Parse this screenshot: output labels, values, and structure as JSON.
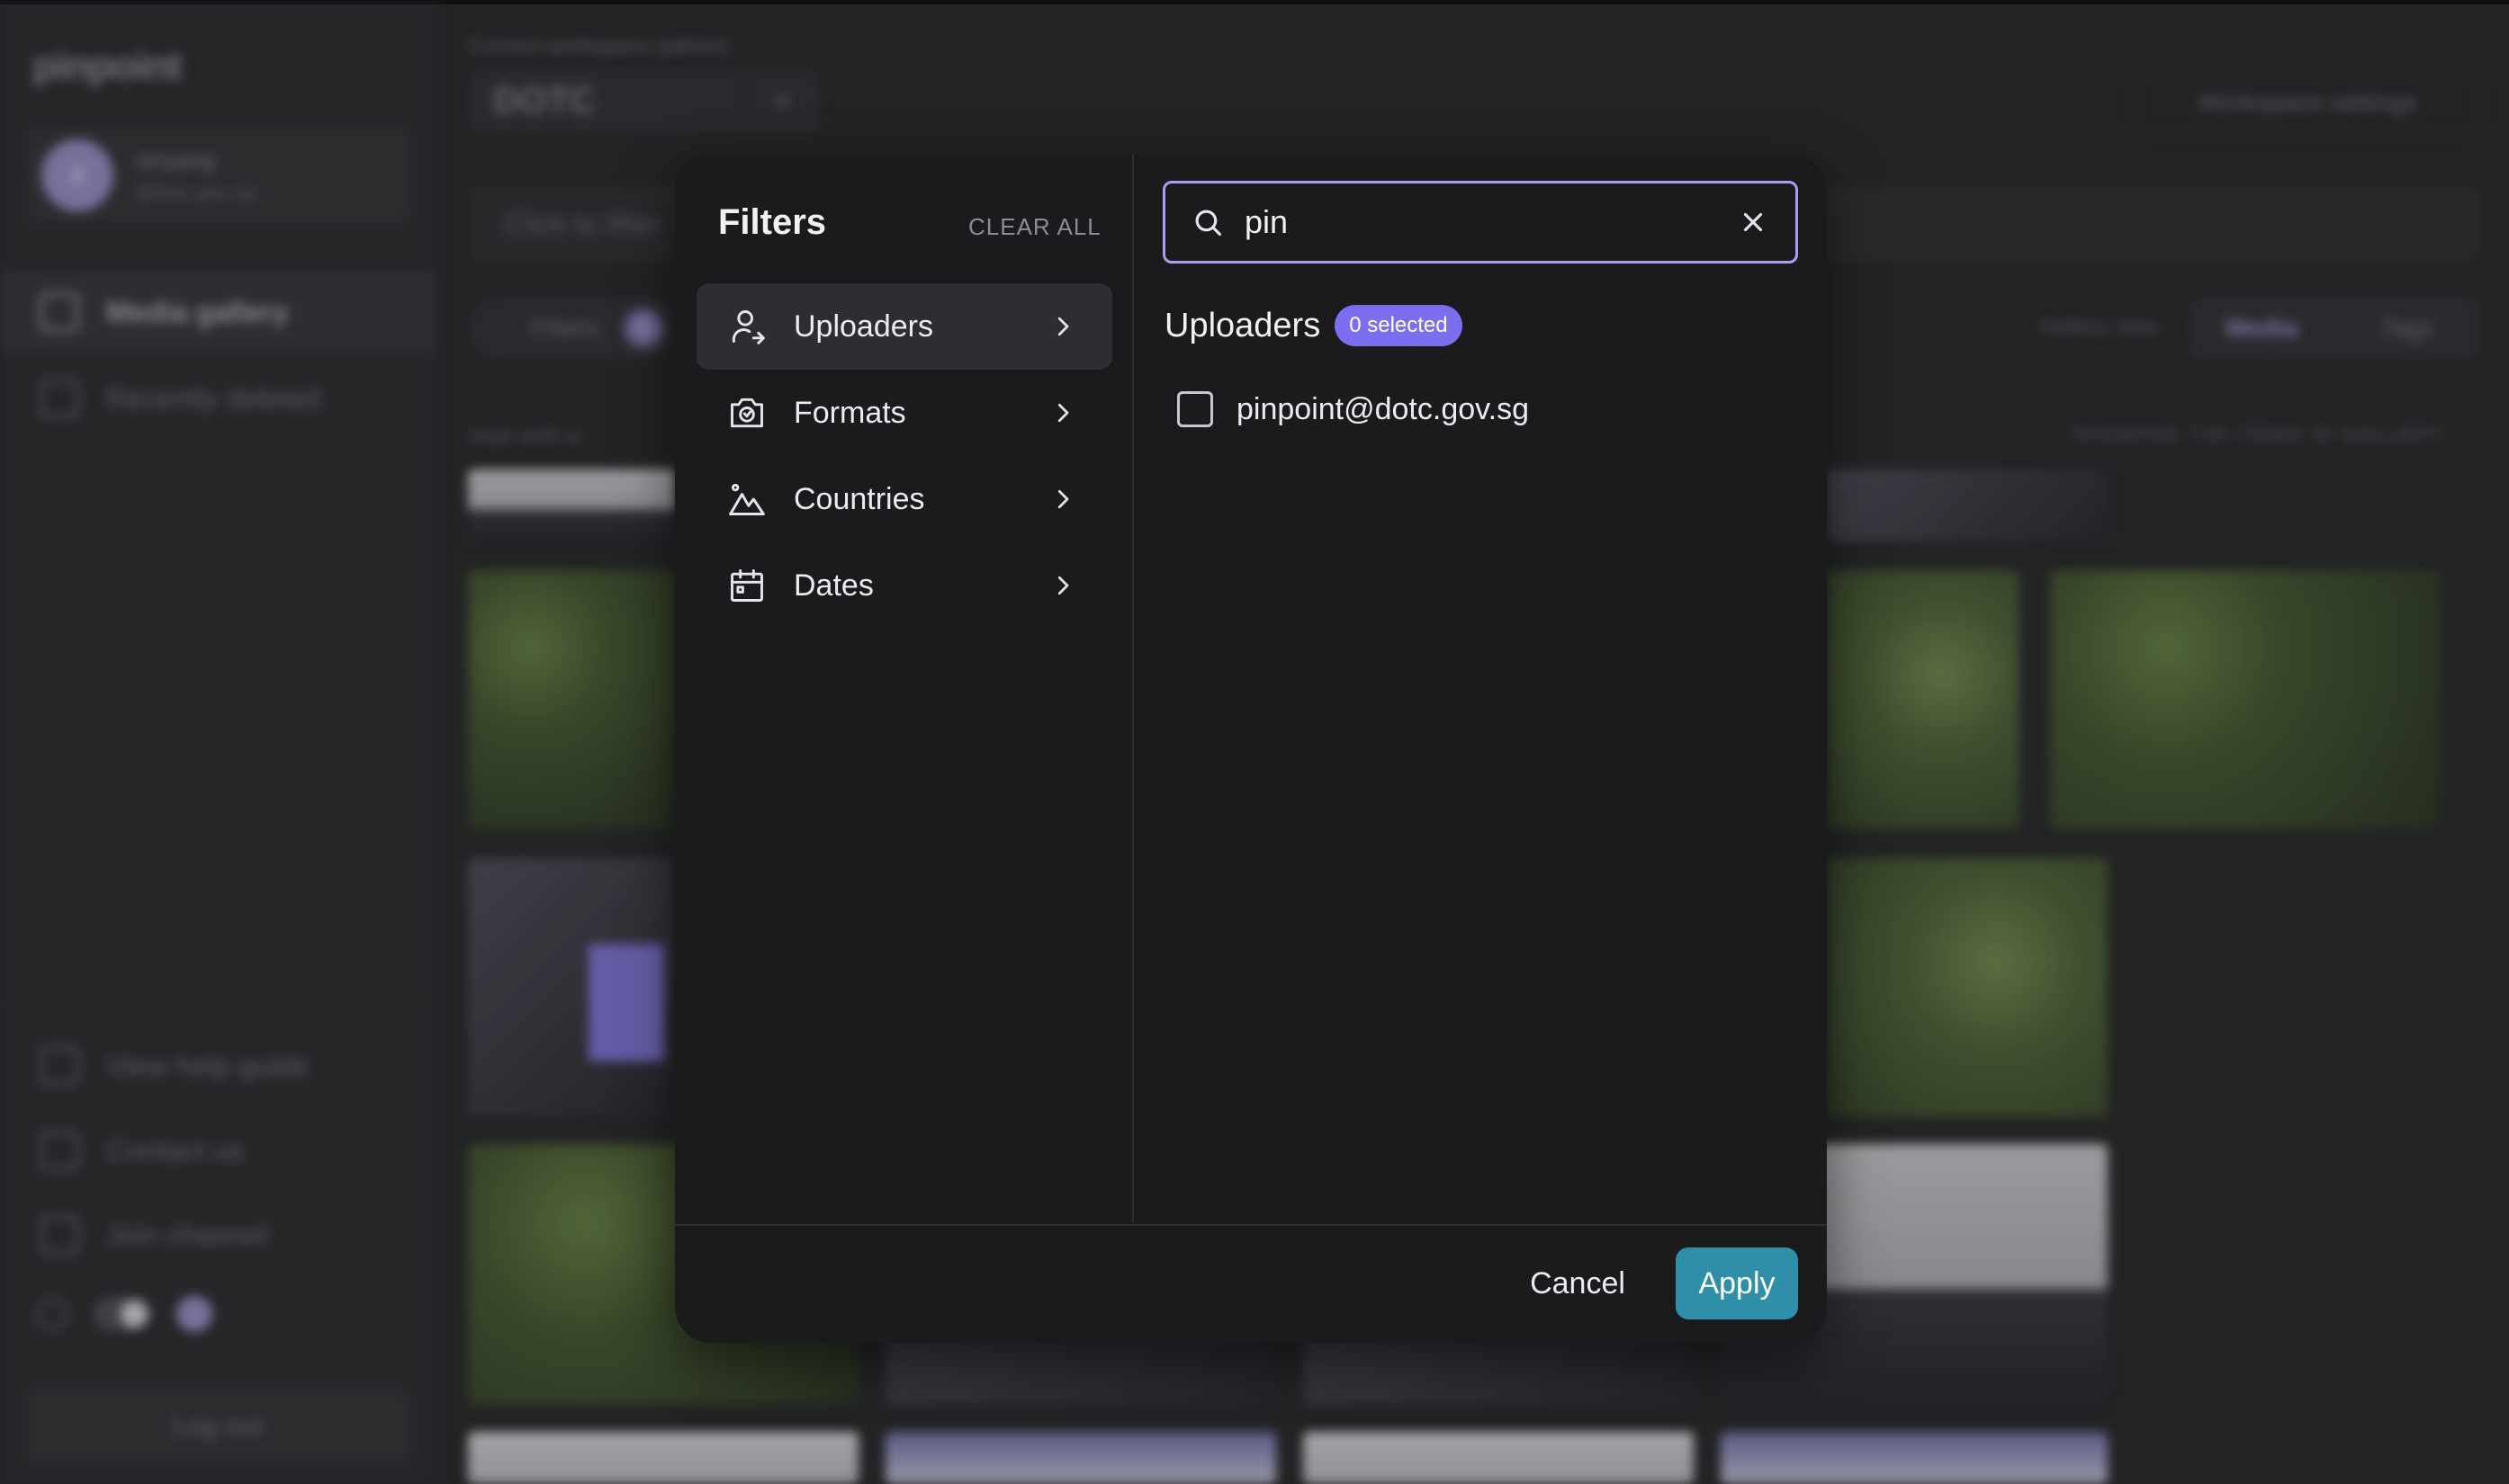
{
  "background": {
    "logo": "pinpoint",
    "user": {
      "initial": "X",
      "name": "xinyang",
      "email": "@dotc.gov.sg"
    },
    "nav": {
      "media_gallery": "Media gallery",
      "recently_deleted": "Recently deleted"
    },
    "footer_nav": {
      "help": "View help guide",
      "contact": "Contact us",
      "channel": "Join channel"
    },
    "logout": "Log out",
    "workspace_label": "Current workspace (admin)",
    "workspace_name": "DOTC",
    "workspace_add": "+",
    "workspace_settings": "Workspace settings",
    "search_placeholder": "Click to filter",
    "filters_label": "Filters",
    "filters_count": "5",
    "gallery_view_label": "Gallery view:",
    "view_options": {
      "media": "Media",
      "tags": "Tags"
    },
    "hold_hint": {
      "prefix": "Hold",
      "key": "shift",
      "suffix": "or"
    },
    "showing_text": "SHOWING 718 ITEMS IN GALLERY"
  },
  "modal": {
    "title": "Filters",
    "clear_all": "CLEAR ALL",
    "categories": [
      {
        "label": "Uploaders",
        "icon": "user-icon",
        "active": true
      },
      {
        "label": "Formats",
        "icon": "camera-icon",
        "active": false
      },
      {
        "label": "Countries",
        "icon": "mountain-icon",
        "active": false
      },
      {
        "label": "Dates",
        "icon": "calendar-icon",
        "active": false
      }
    ],
    "search": {
      "value": "pin"
    },
    "section": {
      "title": "Uploaders",
      "badge": "0 selected"
    },
    "options": [
      {
        "label": "pinpoint@dotc.gov.sg",
        "checked": false
      }
    ],
    "footer": {
      "cancel": "Cancel",
      "apply": "Apply"
    }
  },
  "colors": {
    "accent": "#7b6ff0",
    "focus_border": "#a99ef0",
    "apply": "#2f8ea8",
    "modal_bg": "#1b1b1e"
  }
}
